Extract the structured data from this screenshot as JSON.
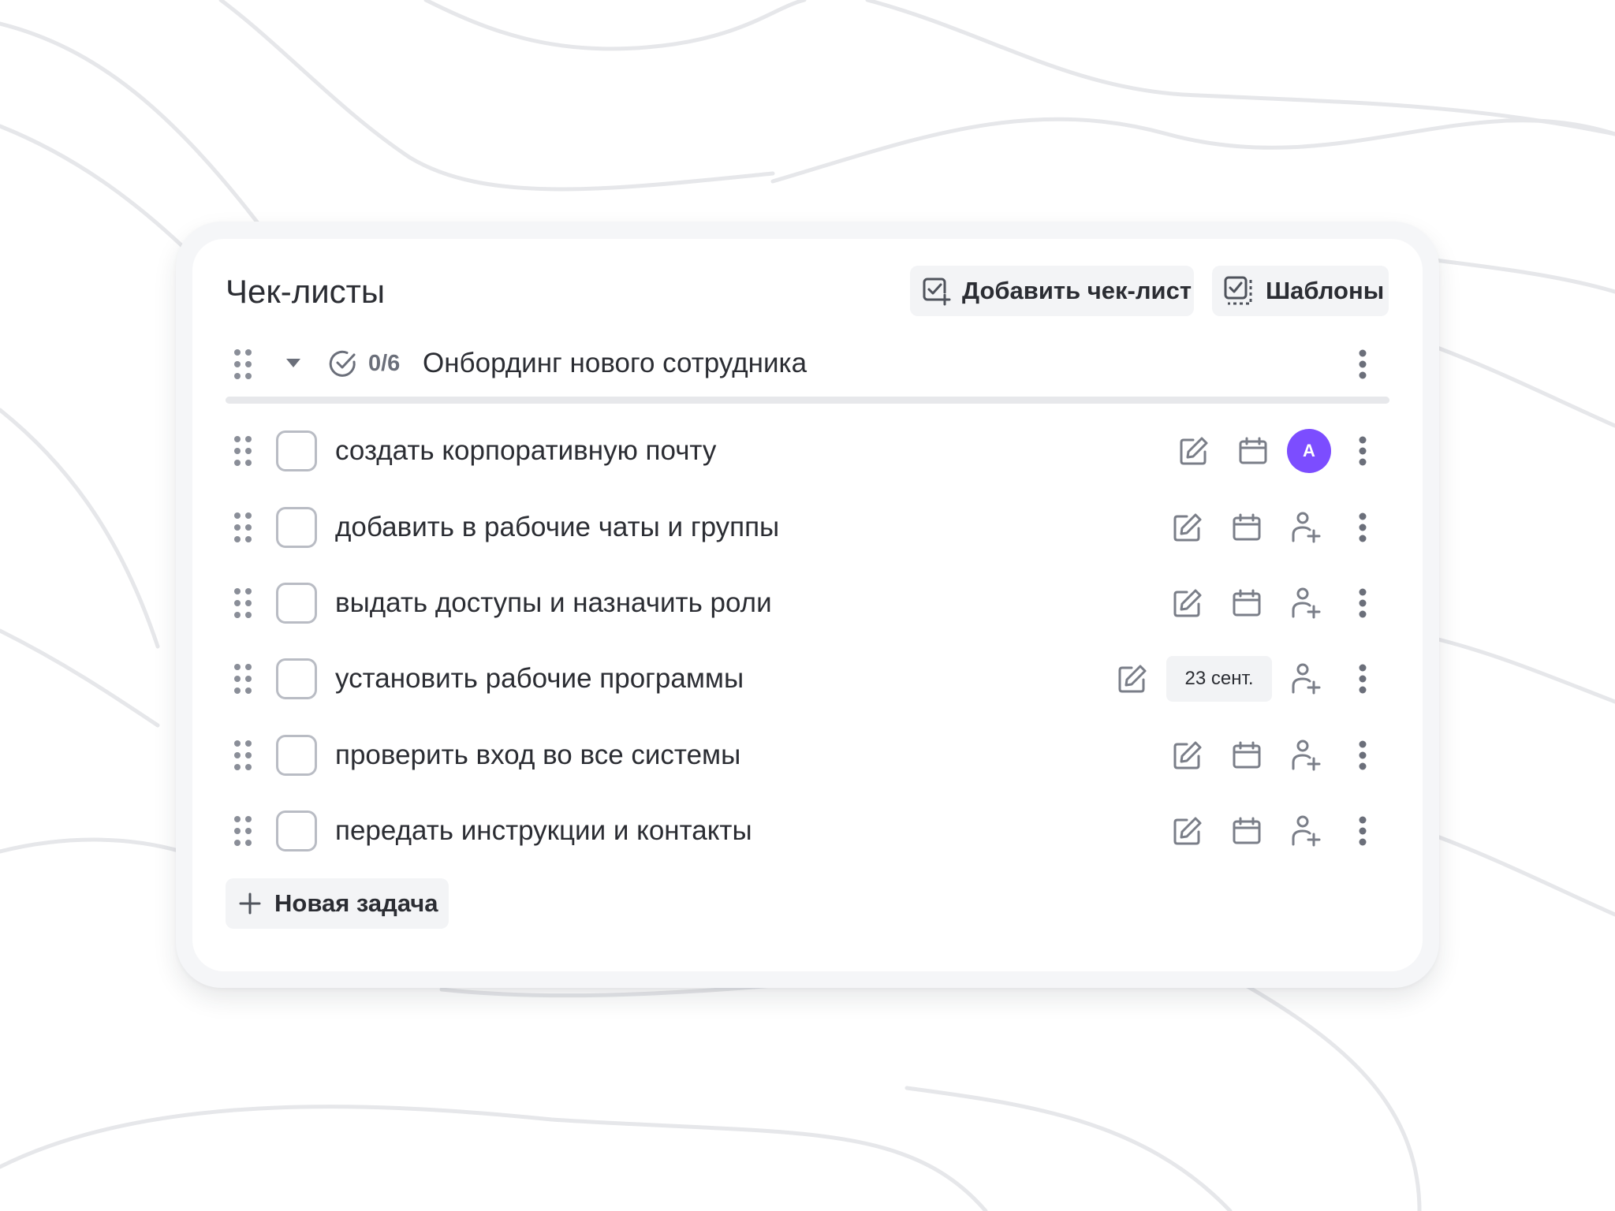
{
  "header": {
    "title": "Чек-листы",
    "add_checklist_label": "Добавить чек-лист",
    "templates_label": "Шаблоны"
  },
  "checklist": {
    "title": "Онбординг нового сотрудника",
    "count_label": "0/6",
    "completed": 0,
    "total": 6,
    "progress": 0
  },
  "tasks": [
    {
      "text": "создать корпоративную почту",
      "assignee_initial": "А"
    },
    {
      "text": "добавить в рабочие чаты и группы"
    },
    {
      "text": "выдать доступы и назначить роли"
    },
    {
      "text": "установить рабочие программы",
      "due_date": "23 сент."
    },
    {
      "text": "проверить вход во все системы"
    },
    {
      "text": "передать инструкции и контакты"
    }
  ],
  "new_task_label": "Новая задача",
  "icons": {
    "drag": "drag-handle-icon",
    "collapse": "chevron-down-icon",
    "progress": "check-circle-icon",
    "edit": "pencil-icon",
    "calendar": "calendar-icon",
    "assign": "add-user-icon",
    "more": "more-vertical-icon",
    "add": "plus-icon"
  },
  "colors": {
    "accent": "#7c4dff",
    "icon": "#7a7e88",
    "chip_bg": "#f3f4f6"
  }
}
